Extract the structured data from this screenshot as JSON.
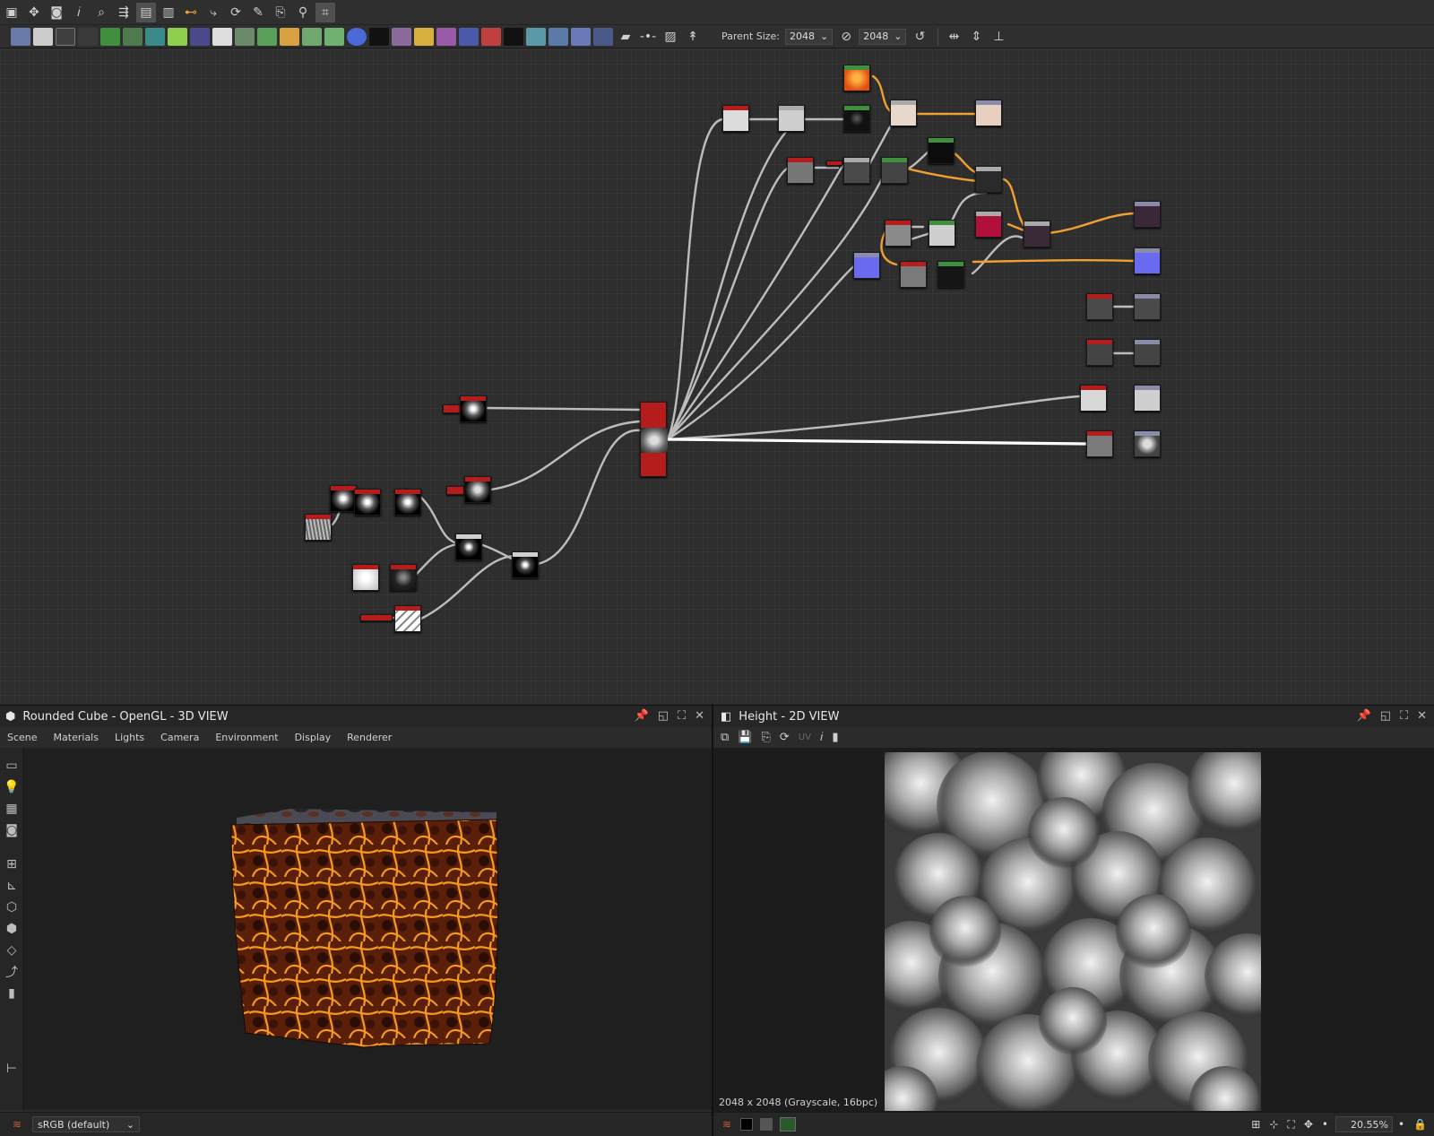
{
  "toolbar": {
    "parent_size_label": "Parent Size:",
    "parent_size_w": "2048",
    "parent_size_h": "2048"
  },
  "panel3d": {
    "title": "Rounded Cube - OpenGL - 3D VIEW",
    "menu": [
      "Scene",
      "Materials",
      "Lights",
      "Camera",
      "Environment",
      "Display",
      "Renderer"
    ],
    "colorspace": "sRGB (default)"
  },
  "panel2d": {
    "title": "Height - 2D VIEW",
    "uv_label": "UV",
    "info": "2048 x 2048 (Grayscale, 16bpc)",
    "zoom": "20.55%"
  },
  "colors": {
    "accent_orange": "#f0a030",
    "node_red": "#b01c1c",
    "link_gray": "#bdbdbd"
  }
}
